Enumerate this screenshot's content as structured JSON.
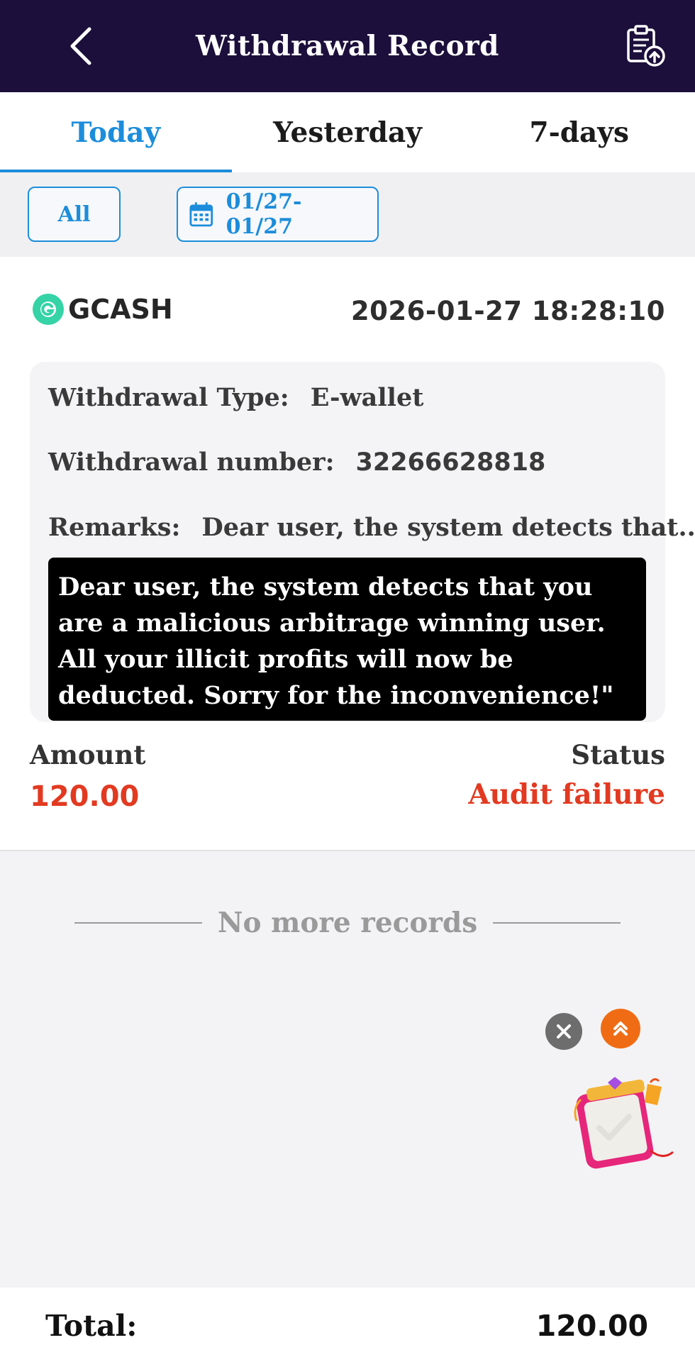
{
  "header": {
    "title": "Withdrawal Record",
    "back_icon": "chevron-left-icon",
    "record_icon": "clipboard-upload-icon"
  },
  "tabs": [
    {
      "label": "Today",
      "active": true
    },
    {
      "label": "Yesterday",
      "active": false
    },
    {
      "label": "7-days",
      "active": false
    }
  ],
  "filters": {
    "type_label": "All",
    "date_range": "01/27- 01/27",
    "date_icon": "calendar-icon"
  },
  "record": {
    "channel": "GCASH",
    "datetime": "2026-01-27 18:28:10",
    "withdrawal_type_label": "Withdrawal Type:",
    "withdrawal_type_value": "E-wallet",
    "withdrawal_number_label": "Withdrawal number:",
    "withdrawal_number_value": "32266628818",
    "remarks_label": "Remarks:",
    "remarks_value": "Dear user, the system detects that...",
    "remarks_full": "Dear user, the system detects that you are a malicious arbitrage winning user. All your illicit profits will now be deducted. Sorry for the inconvenience!\"",
    "amount_label": "Amount",
    "amount_value": "120.00",
    "status_label": "Status",
    "status_value": "Audit failure"
  },
  "list_end_text": "No more records",
  "footer": {
    "total_label": "Total:",
    "total_value": "120.00"
  },
  "colors": {
    "header_bg": "#1c0f3b",
    "accent": "#1c8ddb",
    "error": "#e23a21",
    "scroll_top_button": "#f06c14"
  }
}
